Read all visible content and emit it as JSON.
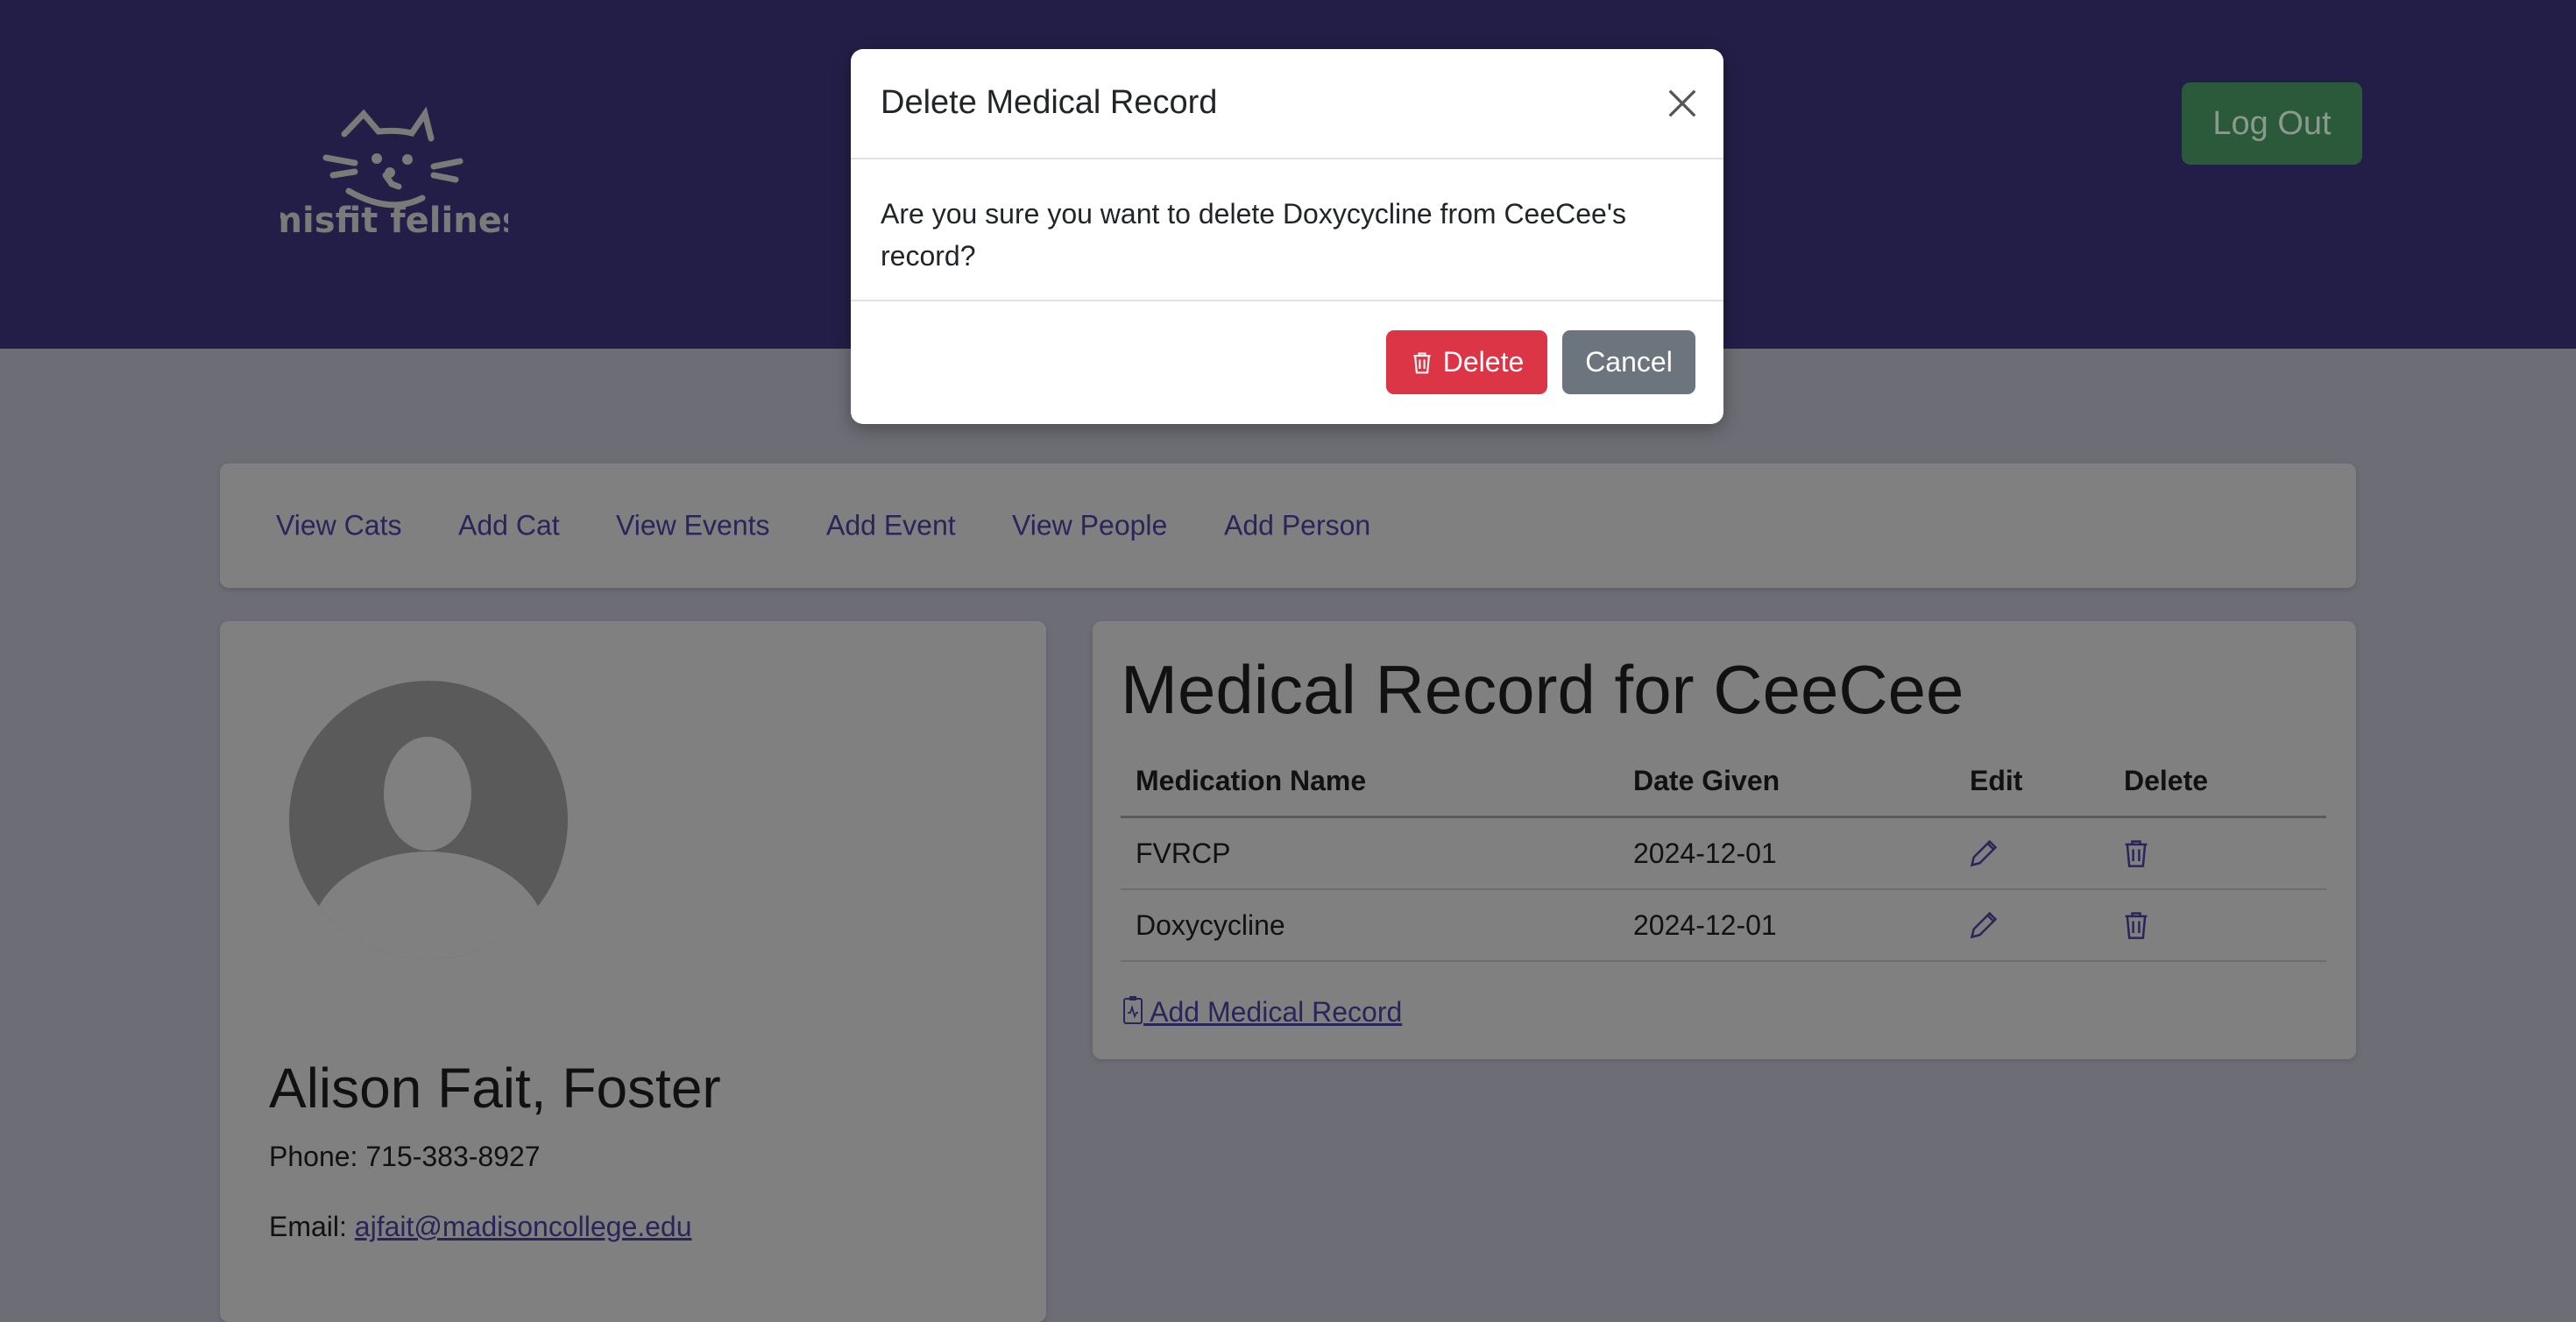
{
  "header": {
    "logo_text": "misfit felines",
    "logout_label": "Log Out"
  },
  "nav": {
    "items": [
      "View Cats",
      "Add Cat",
      "View Events",
      "Add Event",
      "View People",
      "Add Person"
    ]
  },
  "person": {
    "name": "Alison Fait, Foster",
    "phone_label": "Phone:",
    "phone": "715-383-8927",
    "email_label": "Email:",
    "email": "ajfait@madisoncollege.edu"
  },
  "medical": {
    "title": "Medical Record for CeeCee",
    "columns": [
      "Medication Name",
      "Date Given",
      "Edit",
      "Delete"
    ],
    "rows": [
      {
        "name": "FVRCP",
        "date": "2024-12-01"
      },
      {
        "name": "Doxycycline",
        "date": "2024-12-01"
      }
    ],
    "add_label": " Add Medical Record"
  },
  "modal": {
    "title": "Delete Medical Record",
    "message_line1": "Are you sure you want to delete Doxycycline from CeeCee's",
    "message_line2": "record?",
    "delete_label": "Delete",
    "cancel_label": "Cancel"
  },
  "colors": {
    "header": "#221e47",
    "delete": "#dc3545",
    "cancel": "#6c757d",
    "logout": "#198754"
  }
}
